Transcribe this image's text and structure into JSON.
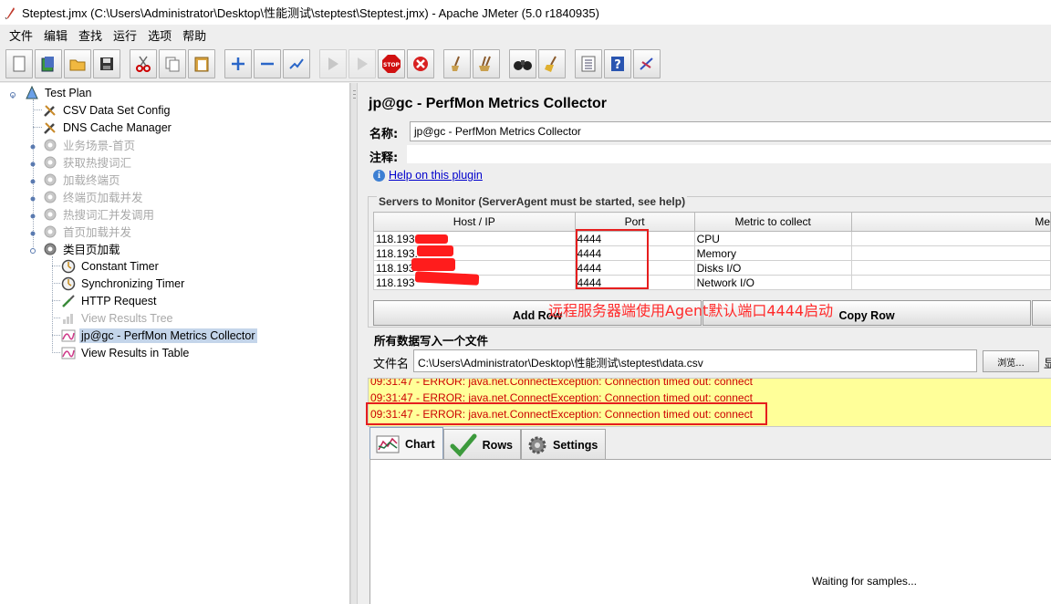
{
  "window": {
    "title": "Steptest.jmx (C:\\Users\\Administrator\\Desktop\\性能测试\\steptest\\Steptest.jmx) - Apache JMeter (5.0 r1840935)"
  },
  "menu": [
    "文件",
    "编辑",
    "查找",
    "运行",
    "选项",
    "帮助"
  ],
  "toolbar": {
    "buttons": [
      "new-icon",
      "templates-icon",
      "open-icon",
      "save-icon",
      "cut-icon",
      "copy-icon",
      "paste-icon",
      "expand-icon",
      "collapse-icon",
      "toggle-icon",
      "start-icon",
      "start-no-pause-icon",
      "stop-icon",
      "shutdown-icon",
      "clear-icon",
      "clear-all-icon",
      "search-icon",
      "reset-search-icon",
      "function-helper-icon",
      "help-icon",
      "remote-icon"
    ]
  },
  "tree": {
    "items": [
      {
        "label": "Test Plan",
        "icon": "test-plan-icon",
        "disabled": false
      },
      {
        "label": "CSV Data Set Config",
        "icon": "wrench-icon",
        "disabled": false
      },
      {
        "label": "DNS Cache Manager",
        "icon": "wrench-icon",
        "disabled": false
      },
      {
        "label": "业务场景-首页",
        "icon": "thread-group-icon",
        "disabled": true
      },
      {
        "label": "获取热搜词汇",
        "icon": "thread-group-icon",
        "disabled": true
      },
      {
        "label": "加载终端页",
        "icon": "thread-group-icon",
        "disabled": true
      },
      {
        "label": "终端页加载并发",
        "icon": "thread-group-icon",
        "disabled": true
      },
      {
        "label": "热搜词汇并发调用",
        "icon": "thread-group-icon",
        "disabled": true
      },
      {
        "label": "首页加载并发",
        "icon": "thread-group-icon",
        "disabled": true
      },
      {
        "label": "类目页加载",
        "icon": "thread-group-icon",
        "disabled": false
      },
      {
        "label": "Constant Timer",
        "icon": "timer-icon",
        "disabled": false
      },
      {
        "label": "Synchronizing Timer",
        "icon": "timer-icon",
        "disabled": false
      },
      {
        "label": "HTTP Request",
        "icon": "sampler-icon",
        "disabled": false
      },
      {
        "label": "View Results Tree",
        "icon": "listener-icon",
        "disabled": true
      },
      {
        "label": "jp@gc - PerfMon Metrics Collector",
        "icon": "perfmon-icon",
        "disabled": false,
        "selected": true
      },
      {
        "label": "View Results in Table",
        "icon": "listener-icon",
        "disabled": false
      }
    ]
  },
  "panel": {
    "title": "jp@gc - PerfMon Metrics Collector",
    "name_label": "名称:",
    "name_value": "jp@gc - PerfMon Metrics Collector",
    "comment_label": "注释:",
    "help_link": "Help on this plugin",
    "servers_legend": "Servers to Monitor (ServerAgent must be started, see help)",
    "columns": [
      "Host / IP",
      "Port",
      "Metric to collect",
      "Me"
    ],
    "rows": [
      {
        "host": "118.193.",
        "port": "4444",
        "metric": "CPU"
      },
      {
        "host": "118.193.",
        "port": "4444",
        "metric": "Memory"
      },
      {
        "host": "118.193",
        "port": "4444",
        "metric": "Disks I/O"
      },
      {
        "host": "118.193",
        "port": "4444",
        "metric": "Network I/O"
      }
    ],
    "add_row": "Add Row",
    "copy_row": "Copy Row",
    "annotation": "远程服务器端使用Agent默认端口4444启动",
    "write_all_label": "所有数据写入一个文件",
    "filename_label": "文件名",
    "filename_value": "C:\\Users\\Administrator\\Desktop\\性能测试\\steptest\\data.csv",
    "browse": "浏览...",
    "extra_label": "显",
    "log": [
      "09:31:47 - ERROR: java.net.ConnectException: Connection timed out: connect",
      "09:31:47 - ERROR: java.net.ConnectException: Connection timed out: connect",
      "09:31:47 - ERROR: java.net.ConnectException: Connection timed out: connect"
    ],
    "tabs": [
      "Chart",
      "Rows",
      "Settings"
    ],
    "waiting": "Waiting for samples..."
  }
}
